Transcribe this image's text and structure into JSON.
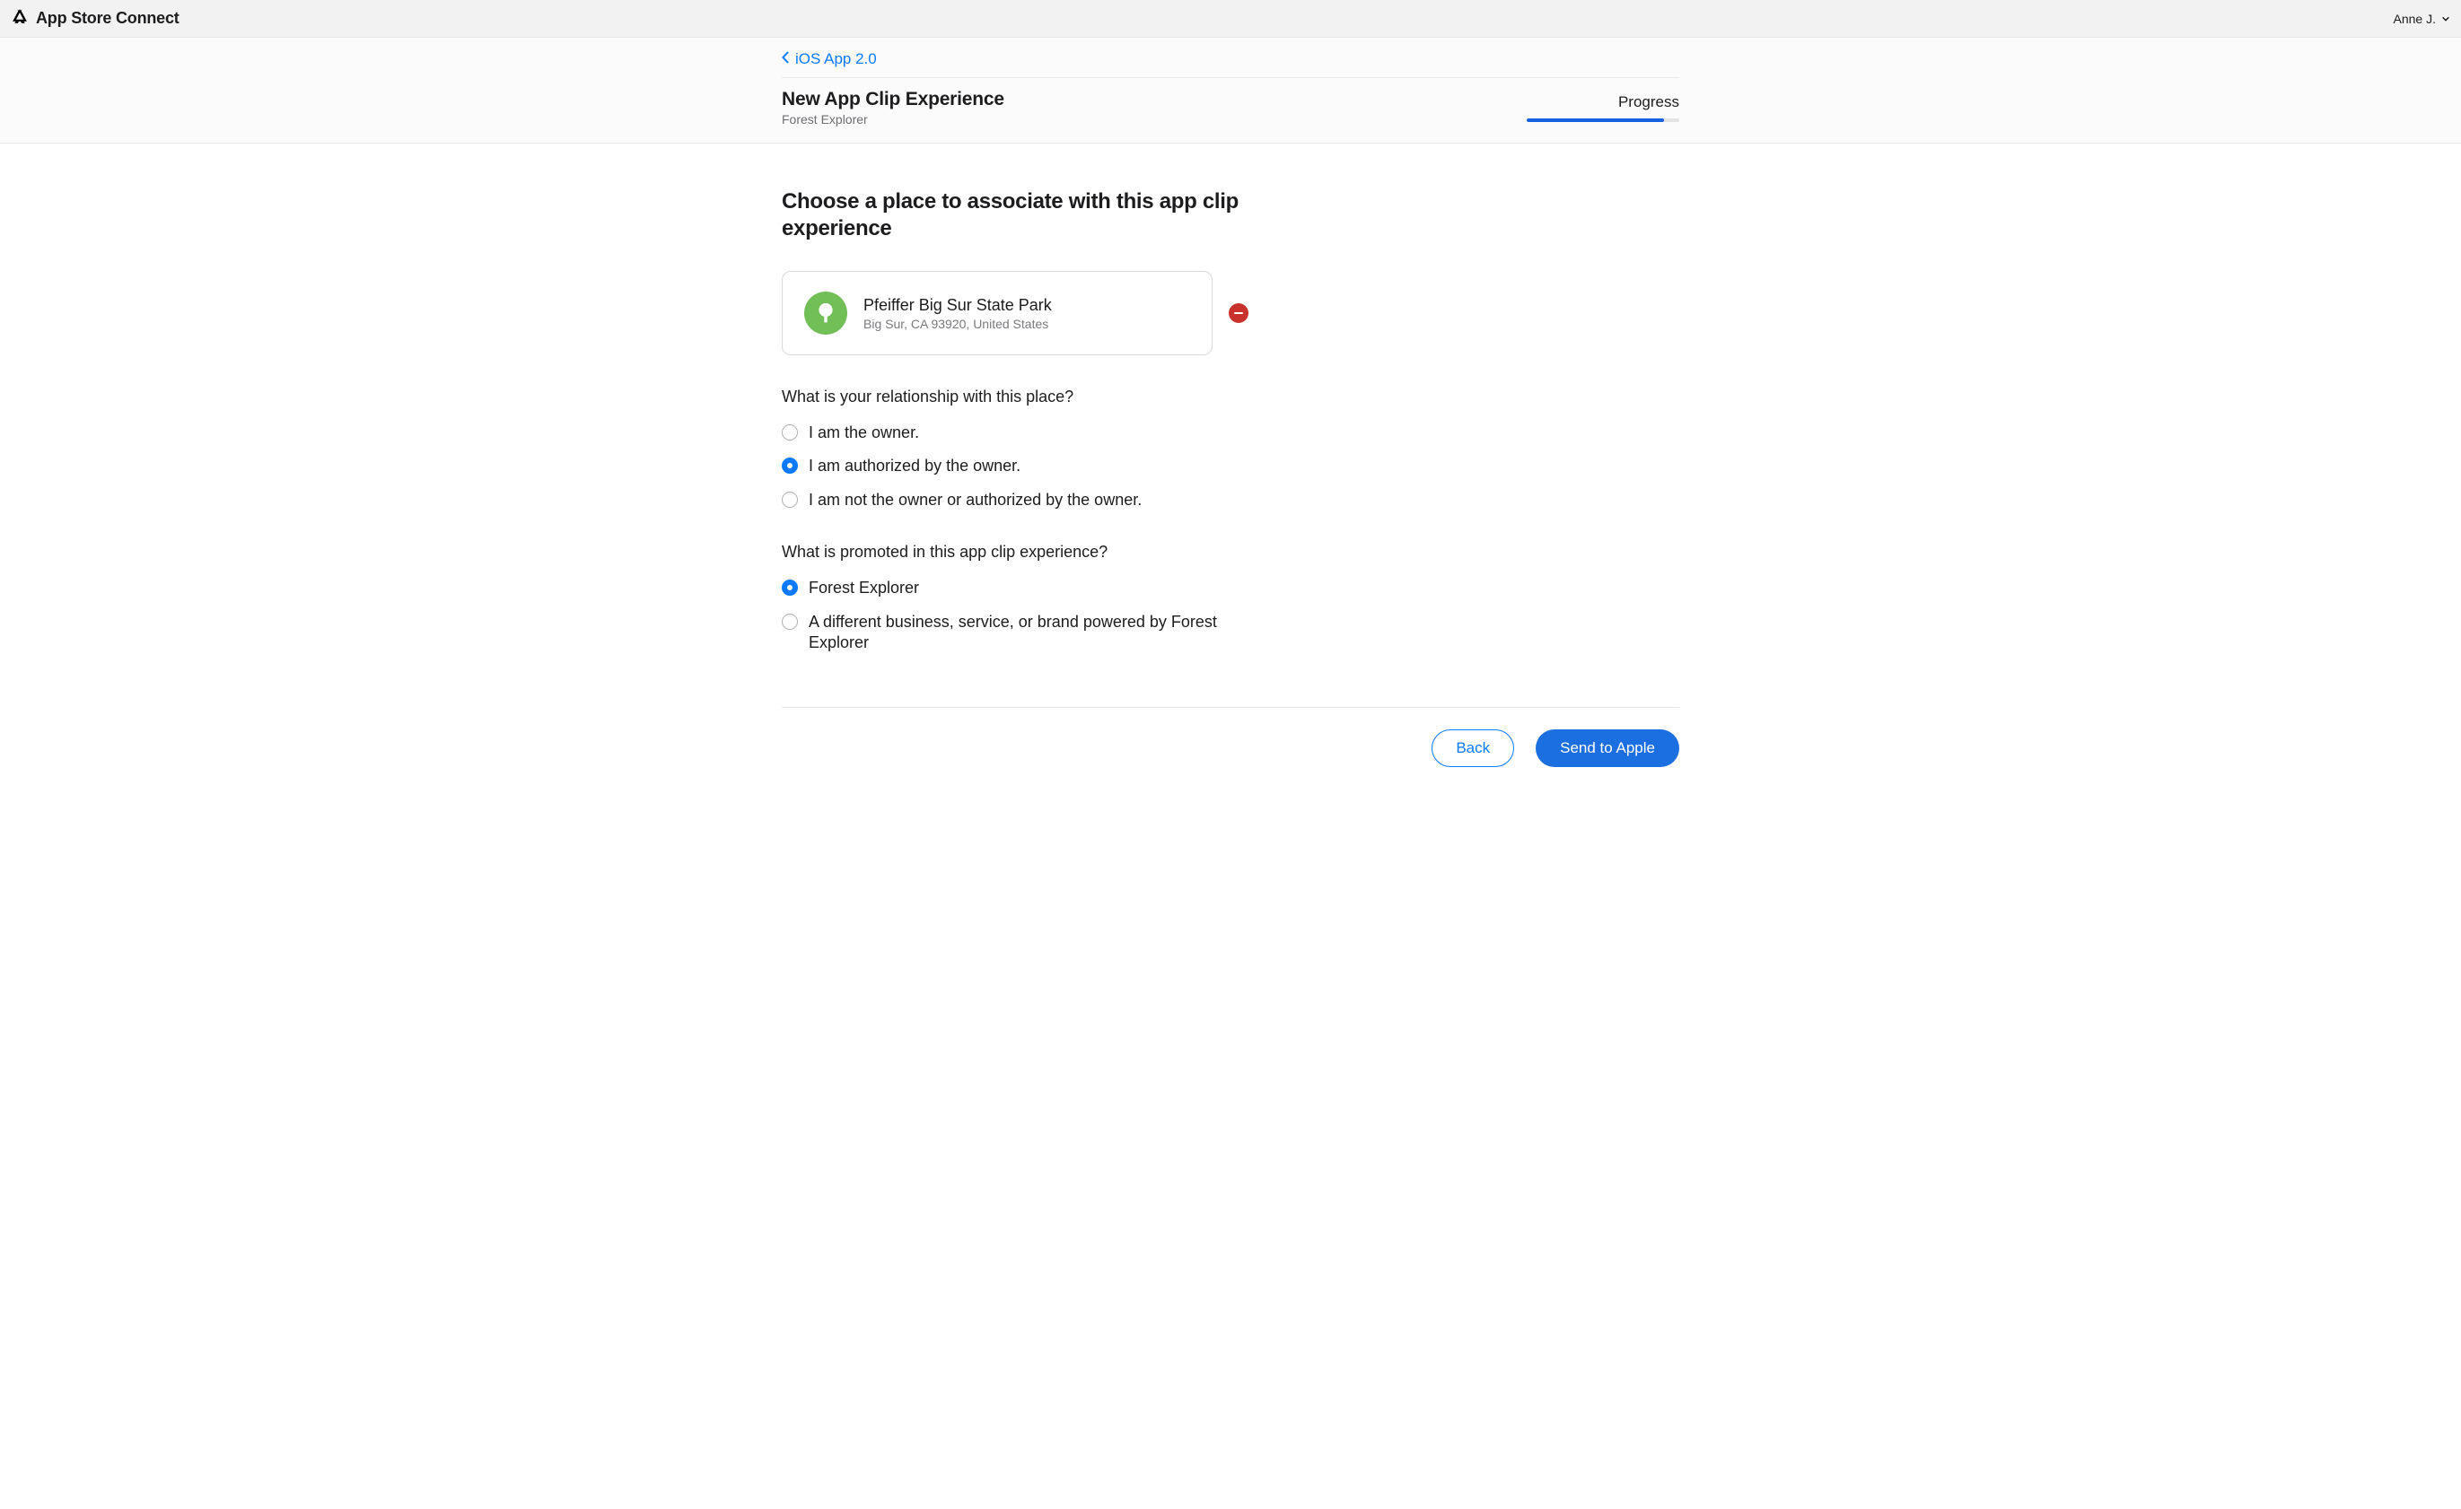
{
  "topbar": {
    "app_name": "App Store Connect",
    "user_label": "Anne J."
  },
  "breadcrumb": {
    "back_label": "iOS App 2.0"
  },
  "header": {
    "title": "New App Clip Experience",
    "subtitle": "Forest Explorer",
    "progress_label": "Progress",
    "progress_percent": 90
  },
  "main": {
    "section_title": "Choose a place to associate with this app clip experience",
    "place": {
      "name": "Pfeiffer Big Sur State Park",
      "address": "Big Sur, CA 93920, United States"
    },
    "question1": {
      "prompt": "What is your relationship with this place?",
      "options": [
        {
          "label": "I am the owner.",
          "checked": false
        },
        {
          "label": "I am authorized by the owner.",
          "checked": true
        },
        {
          "label": "I am not the owner or authorized by the owner.",
          "checked": false
        }
      ]
    },
    "question2": {
      "prompt": "What is promoted in this app clip experience?",
      "options": [
        {
          "label": "Forest Explorer",
          "checked": true
        },
        {
          "label": "A different business, service, or brand powered by Forest Explorer",
          "checked": false
        }
      ]
    }
  },
  "footer": {
    "back_label": "Back",
    "submit_label": "Send to Apple"
  }
}
